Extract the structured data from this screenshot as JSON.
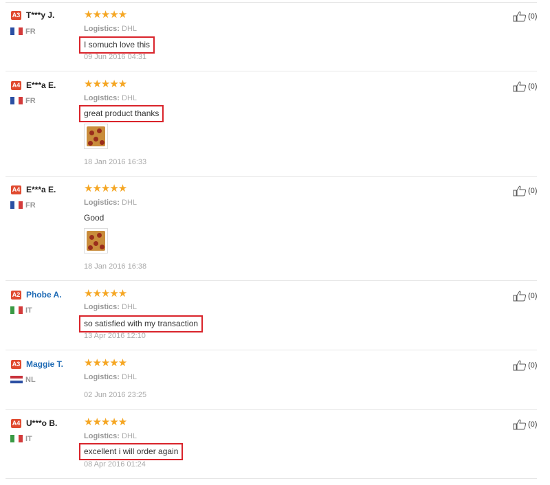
{
  "reviews": [
    {
      "level": "A3",
      "name": "T***y J.",
      "country": "FR",
      "stars": "★★★★★",
      "logistics_label": "Logistics:",
      "logistics_value": "DHL",
      "comment": "I somuch love this",
      "date": "09 Jun 2016 04:31",
      "likes": "(0)"
    },
    {
      "level": "A4",
      "name": "E***a E.",
      "country": "FR",
      "stars": "★★★★★",
      "logistics_label": "Logistics:",
      "logistics_value": "DHL",
      "comment": "great product thanks",
      "date": "18 Jan 2016 16:33",
      "likes": "(0)"
    },
    {
      "level": "A4",
      "name": "E***a E.",
      "country": "FR",
      "stars": "★★★★★",
      "logistics_label": "Logistics:",
      "logistics_value": "DHL",
      "comment": "Good",
      "date": "18 Jan 2016 16:38",
      "likes": "(0)"
    },
    {
      "level": "A2",
      "name": "Phobe A.",
      "country": "IT",
      "stars": "★★★★★",
      "logistics_label": "Logistics:",
      "logistics_value": "DHL",
      "comment": "so satisfied with my transaction",
      "date": "13 Apr 2016 12:10",
      "likes": "(0)"
    },
    {
      "level": "A3",
      "name": "Maggie T.",
      "country": "NL",
      "stars": "★★★★★",
      "logistics_label": "Logistics:",
      "logistics_value": "DHL",
      "comment": "",
      "date": "02 Jun 2016 23:25",
      "likes": "(0)"
    },
    {
      "level": "A4",
      "name": "U***o B.",
      "country": "IT",
      "stars": "★★★★★",
      "logistics_label": "Logistics:",
      "logistics_value": "DHL",
      "comment": "excellent i will order again",
      "date": "08 Apr 2016 01:24",
      "likes": "(0)"
    }
  ],
  "icons": {
    "like": "thumbs-up-icon",
    "photo": "review-photo-thumbnail"
  },
  "colors": {
    "badge": "#e04a2f",
    "stars": "#f5a623",
    "highlight_box": "#d9232a",
    "name_link": "#1f6bb5"
  }
}
